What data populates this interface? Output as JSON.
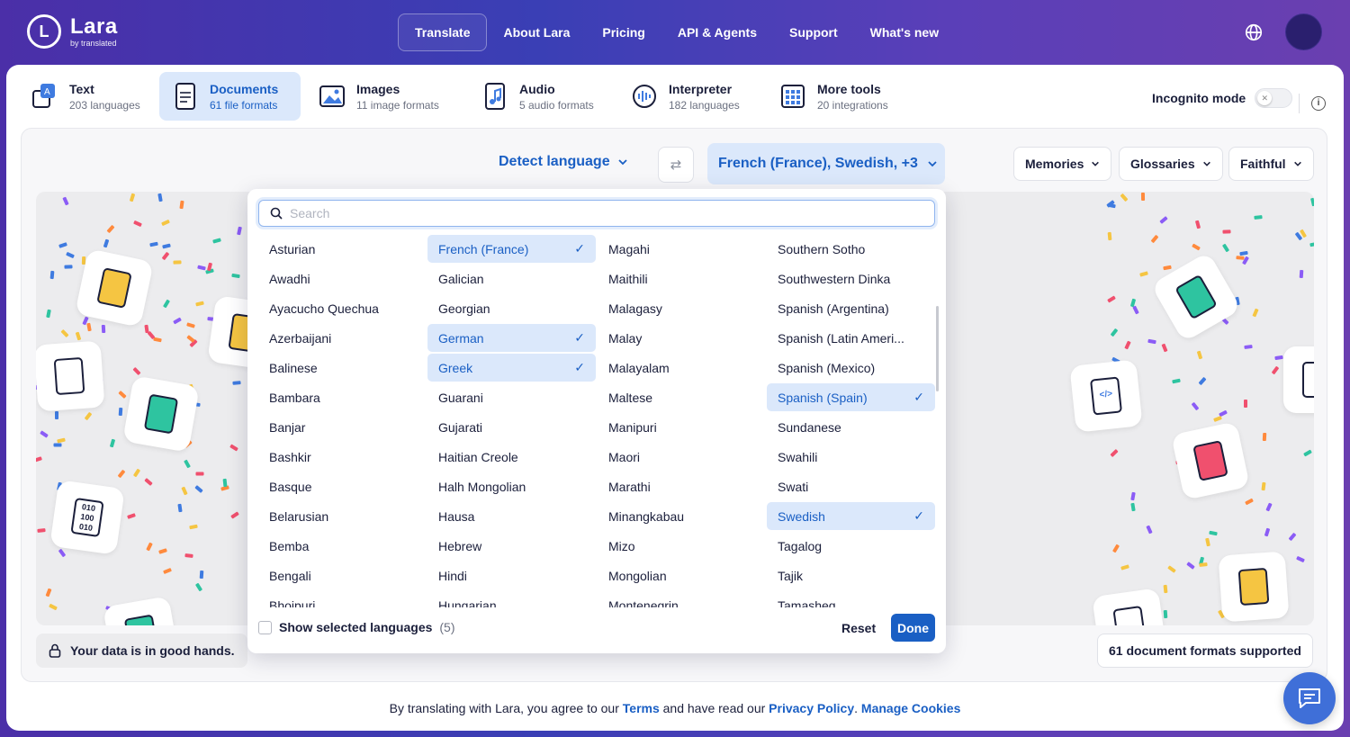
{
  "brand": {
    "name": "Lara",
    "sub": "by translated",
    "mark": "L"
  },
  "nav": {
    "items": [
      {
        "label": "Translate",
        "active": true
      },
      {
        "label": "About Lara"
      },
      {
        "label": "Pricing"
      },
      {
        "label": "API & Agents"
      },
      {
        "label": "Support"
      },
      {
        "label": "What's new"
      }
    ]
  },
  "tools": [
    {
      "name": "Text",
      "sub": "203 languages",
      "icon": "text-translate-icon"
    },
    {
      "name": "Documents",
      "sub": "61 file formats",
      "icon": "document-icon",
      "active": true
    },
    {
      "name": "Images",
      "sub": "11 image formats",
      "icon": "image-icon"
    },
    {
      "name": "Audio",
      "sub": "5 audio formats",
      "icon": "audio-icon"
    },
    {
      "name": "Interpreter",
      "sub": "182 languages",
      "icon": "interpreter-icon"
    },
    {
      "name": "More tools",
      "sub": "20 integrations",
      "icon": "grid-icon"
    }
  ],
  "incognito": {
    "label": "Incognito mode",
    "on": false
  },
  "language_bar": {
    "source": "Detect language",
    "target": "French (France), Swedish, +3",
    "options": [
      "Memories",
      "Glossaries",
      "Faithful"
    ]
  },
  "dropdown": {
    "search_placeholder": "Search",
    "columns": [
      [
        "Asturian",
        "Awadhi",
        "Ayacucho Quechua",
        "Azerbaijani",
        "Balinese",
        "Bambara",
        "Banjar",
        "Bashkir",
        "Basque",
        "Belarusian",
        "Bemba",
        "Bengali",
        "Bhojpuri"
      ],
      [
        "French (France)",
        "Galician",
        "Georgian",
        "German",
        "Greek",
        "Guarani",
        "Gujarati",
        "Haitian Creole",
        "Halh Mongolian",
        "Hausa",
        "Hebrew",
        "Hindi",
        "Hungarian"
      ],
      [
        "Magahi",
        "Maithili",
        "Malagasy",
        "Malay",
        "Malayalam",
        "Maltese",
        "Manipuri",
        "Maori",
        "Marathi",
        "Minangkabau",
        "Mizo",
        "Mongolian",
        "Montenegrin"
      ],
      [
        "Southern Sotho",
        "Southwestern Dinka",
        "Spanish (Argentina)",
        "Spanish (Latin Ameri...",
        "Spanish (Mexico)",
        "Spanish (Spain)",
        "Sundanese",
        "Swahili",
        "Swati",
        "Swedish",
        "Tagalog",
        "Tajik",
        "Tamasheq"
      ]
    ],
    "selected": [
      "French (France)",
      "German",
      "Greek",
      "Spanish (Spain)",
      "Swedish"
    ],
    "show_selected_label": "Show selected languages",
    "show_selected_count": "(5)",
    "reset_label": "Reset",
    "done_label": "Done"
  },
  "security_note": "Your data is in good hands.",
  "formats_note": "61 document formats supported",
  "legal": {
    "prefix": "By translating with Lara, you agree to our",
    "terms": "Terms",
    "middle": "and have read our",
    "privacy": "Privacy Policy",
    "dot": ".",
    "cookies": "Manage Cookies"
  },
  "colors": {
    "accent": "#1a5fc4",
    "selected_bg": "#dbe8fb",
    "header_start": "#4b2fa8",
    "header_end": "#6a3fb0"
  }
}
